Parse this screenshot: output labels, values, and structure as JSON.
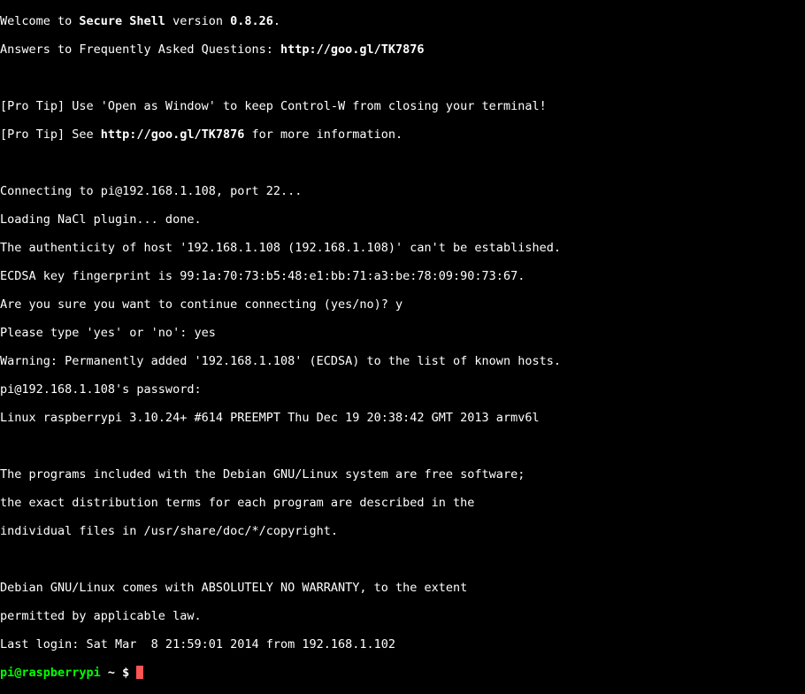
{
  "terminal": {
    "welcome_pre": "Welcome to ",
    "app_name": "Secure Shell",
    "welcome_mid": " version ",
    "version": "0.8.26",
    "welcome_suffix": ".",
    "faq_pre": "Answers to Frequently Asked Questions: ",
    "faq_url": "http://goo.gl/TK7876",
    "protip1": "[Pro Tip] Use 'Open as Window' to keep Control-W from closing your terminal!",
    "protip2_pre": "[Pro Tip] See ",
    "protip2_url": "http://goo.gl/TK7876",
    "protip2_post": " for more information.",
    "connecting": "Connecting to pi@192.168.1.108, port 22...",
    "loading_nacl": "Loading NaCl plugin... done.",
    "authenticity": "The authenticity of host '192.168.1.108 (192.168.1.108)' can't be established.",
    "fingerprint": "ECDSA key fingerprint is 99:1a:70:73:b5:48:e1:bb:71:a3:be:78:09:90:73:67.",
    "continue_prompt": "Are you sure you want to continue connecting (yes/no)? y",
    "please_type": "Please type 'yes' or 'no': yes",
    "warning": "Warning: Permanently added '192.168.1.108' (ECDSA) to the list of known hosts.",
    "password_prompt": "pi@192.168.1.108's password:",
    "kernel": "Linux raspberrypi 3.10.24+ #614 PREEMPT Thu Dec 19 20:38:42 GMT 2013 armv6l",
    "debian1": "The programs included with the Debian GNU/Linux system are free software;",
    "debian2": "the exact distribution terms for each program are described in the",
    "debian3": "individual files in /usr/share/doc/*/copyright.",
    "warranty1": "Debian GNU/Linux comes with ABSOLUTELY NO WARRANTY, to the extent",
    "warranty2": "permitted by applicable law.",
    "last_login": "Last login: Sat Mar  8 21:59:01 2014 from 192.168.1.102",
    "prompt_user": "pi@raspberrypi",
    "prompt_path": " ~ $ "
  }
}
